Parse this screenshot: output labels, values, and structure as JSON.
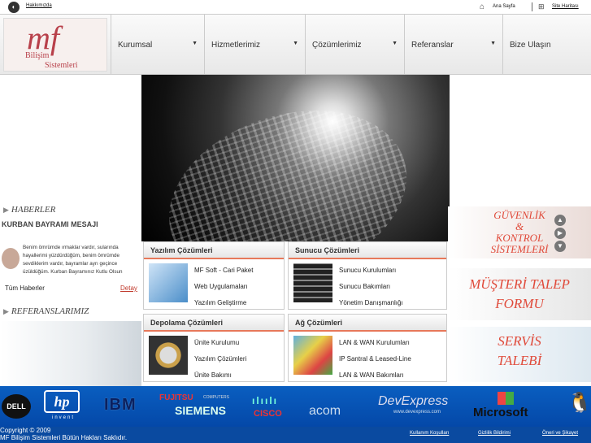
{
  "topbar": {
    "about": "Hakkımızda",
    "home": "Ana Sayfa",
    "sitemap": "Site Haritası"
  },
  "brand": {
    "mark": "mf",
    "line1": "Bilişim",
    "line2": "Sistemleri"
  },
  "nav": [
    {
      "label": "Kurumsal",
      "has_caret": true
    },
    {
      "label": "Hizmetlerimiz",
      "has_caret": true
    },
    {
      "label": "Çözümlerimiz",
      "has_caret": true
    },
    {
      "label": "Referanslar",
      "has_caret": true
    },
    {
      "label": "Bize Ulaşın",
      "has_caret": false
    }
  ],
  "left": {
    "news_heading": "HABERLER",
    "news_title": "KURBAN BAYRAMI MESAJI",
    "news_text": "Benim ömrümde ırmaklar vardır, sularında hayallerimi yüzdürdüğüm, benim ömrümde sevdiklerim vardır, bayramlar ayrı geçince üzüldüğüm. Kurban Bayramınız Kutlu Olsun",
    "all_news": "Tüm Haberler",
    "detail": "Detay",
    "refs_heading": "REFERANSLARIMIZ"
  },
  "banners": {
    "b1": [
      "GÜVENLİK",
      "&",
      "KONTROL",
      "SİSTEMLERİ"
    ],
    "b2": [
      "MÜŞTERİ TALEP",
      "FORMU"
    ],
    "b3": [
      "SERVİS",
      "TALEBİ"
    ]
  },
  "services": [
    {
      "title": "Yazılım Çözümleri",
      "items": [
        "MF Soft - Cari Paket",
        "Web Uygulamaları",
        "Yazılım Geliştirme"
      ]
    },
    {
      "title": "Sunucu Çözümleri",
      "items": [
        "Sunucu Kurulumları",
        "Sunucu Bakımları",
        "Yönetim Danışmanlığı"
      ]
    },
    {
      "title": "Depolama Çözümleri",
      "items": [
        "Ünite Kurulumu",
        "Yazılım Çözümleri",
        "Ünite Bakımı"
      ]
    },
    {
      "title": "Ağ Çözümleri",
      "items": [
        "LAN & WAN Kurulumları",
        "IP Santral & Leased-Line",
        "LAN & WAN Bakımları"
      ]
    }
  ],
  "logos": {
    "dell": "DELL",
    "hp": "hp",
    "hp_sub": "invent",
    "ibm": "IBM",
    "fujitsu": "FUJITSU",
    "fujitsu_sub": "COMPUTERS",
    "siemens": "SIEMENS",
    "cisco": "CISCO",
    "acom": "acom",
    "devexpress": "DevExpress",
    "devexpress_sub": "www.devexpress.com",
    "microsoft": "Microsoft"
  },
  "footer": {
    "copyright": "Copyright © 2009",
    "rights": "MF Bilişim Sistemleri Bütün Hakları Saklıdır.",
    "links": [
      "Kullanım Koşulları",
      "Gizlilik Bildirimi",
      "Öneri ve Şikayet"
    ]
  },
  "colors": {
    "accent": "#e7785a",
    "brand": "#b8404a",
    "strip": "#0a5ec0"
  }
}
